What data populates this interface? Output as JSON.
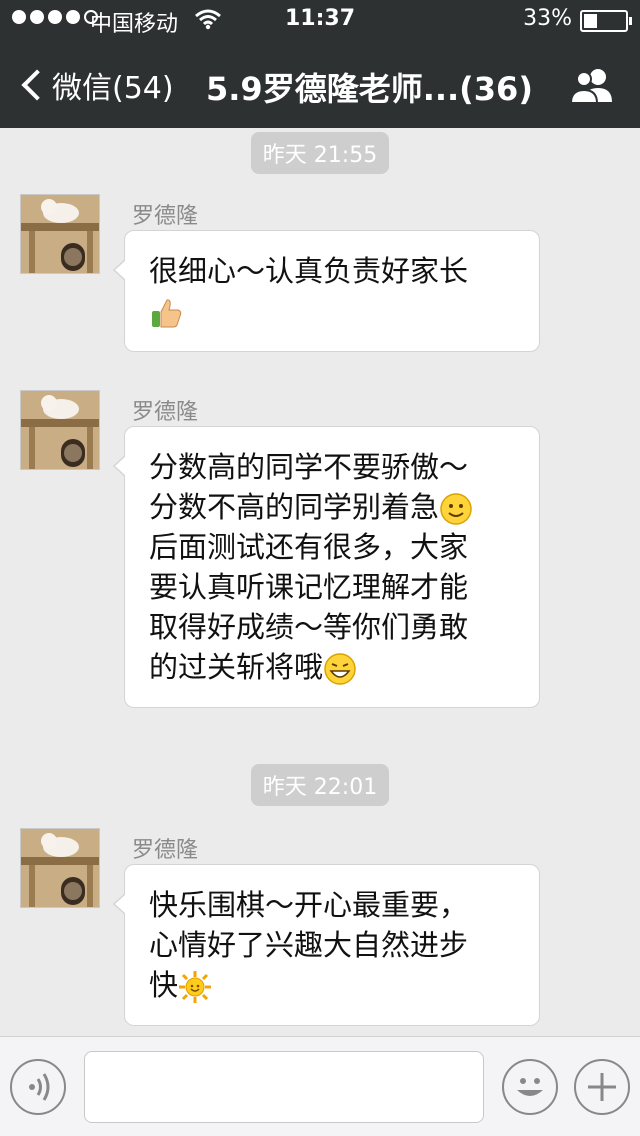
{
  "status_bar": {
    "carrier": "中国移动",
    "time": "11:37",
    "battery_percent_text": "33%",
    "battery_level": 0.33,
    "signal_bars_filled": 4,
    "signal_bars_total": 5
  },
  "nav": {
    "back_label": "微信(54)",
    "title": "5.9罗德隆老师...(36)",
    "icons": {
      "back": "chevron-left-icon",
      "group": "group-members-icon"
    }
  },
  "chat": {
    "timestamps": [
      "昨天 21:55",
      "昨天 22:01"
    ],
    "messages": [
      {
        "sender": "罗德隆",
        "lines": [
          "很细心～认真负责好家长"
        ],
        "tail_emoji": "thumbs-up-icon"
      },
      {
        "sender": "罗德隆",
        "lines": [
          "分数高的同学不要骄傲～",
          "分数不高的同学别着急",
          "后面测试还有很多，大家",
          "要认真听课记忆理解才能",
          "取得好成绩～等你们勇敢",
          "的过关斩将哦"
        ],
        "emojis": [
          "smile-icon",
          "grin-icon"
        ]
      },
      {
        "sender": "罗德隆",
        "lines": [
          "快乐围棋～开心最重要，",
          "心情好了兴趣大自然进步",
          "快"
        ],
        "tail_emoji": "sun-icon"
      }
    ]
  },
  "input_bar": {
    "placeholder": "",
    "icons": {
      "voice": "voice-icon",
      "emoji": "emoji-icon",
      "more": "plus-icon"
    }
  },
  "colors": {
    "nav_bg": "#2e3132",
    "chat_bg": "#ebebeb",
    "bubble_bg": "#ffffff",
    "timestamp_bg": "#cecece"
  }
}
